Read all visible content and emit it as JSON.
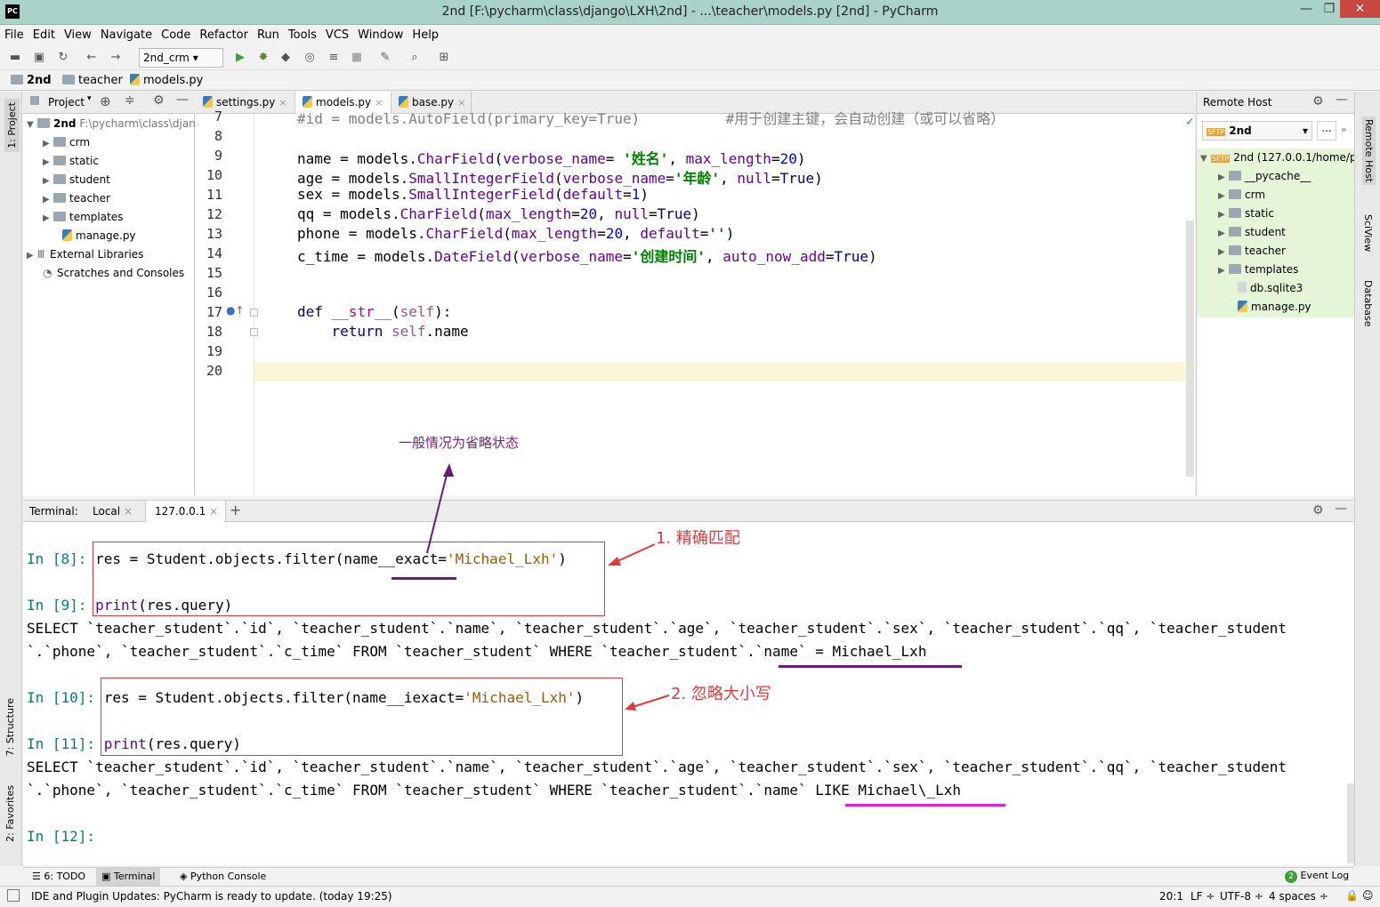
{
  "window": {
    "title": "2nd [F:\\pycharm\\class\\django\\LXH\\2nd] - ...\\teacher\\models.py [2nd] - PyCharm",
    "app_icon": "PC"
  },
  "menu": [
    "File",
    "Edit",
    "View",
    "Navigate",
    "Code",
    "Refactor",
    "Run",
    "Tools",
    "VCS",
    "Window",
    "Help"
  ],
  "toolbar": {
    "run_config": "2nd_crm"
  },
  "breadcrumb": {
    "root": "2nd",
    "folder": "teacher",
    "file": "models.py"
  },
  "left_strip": {
    "project": "1: Project",
    "structure": "7: Structure",
    "favorites": "2: Favorites"
  },
  "project": {
    "header": "Project",
    "root_name": "2nd",
    "root_path": "F:\\pycharm\\class\\djan",
    "folders": [
      "crm",
      "static",
      "student",
      "teacher",
      "templates"
    ],
    "file": "manage.py",
    "external": "External Libraries",
    "scratches": "Scratches and Consoles"
  },
  "tabs": [
    "settings.py",
    "models.py",
    "base.py"
  ],
  "editor": {
    "line_numbers": [
      "7",
      "8",
      "9",
      "10",
      "11",
      "12",
      "13",
      "14",
      "15",
      "16",
      "17",
      "18",
      "19",
      "20"
    ],
    "line7": "#id = models.AutoField(primary_key=True)          #用于创建主键，会自动创建（或可以省略）",
    "annotation": "一般情况为省略状态"
  },
  "remote_host": {
    "header": "Remote Host",
    "server": "2nd",
    "root": "2nd (127.0.0.1/home/py",
    "folders": [
      "__pycache__",
      "crm",
      "static",
      "student",
      "teacher",
      "templates"
    ],
    "files": [
      "db.sqlite3",
      "manage.py"
    ]
  },
  "right_strip": {
    "remote": "Remote Host",
    "sciview": "SciView",
    "database": "Database"
  },
  "terminal": {
    "label": "Terminal:",
    "tabs": [
      "Local",
      "127.0.0.1"
    ],
    "p8": "In [8]:",
    "p9": "In [9]:",
    "p10": "In [10]:",
    "p11": "In [11]:",
    "p12": "In [12]:",
    "sql1a": "SELECT `teacher_student`.`id`, `teacher_student`.`name`, `teacher_student`.`age`, `teacher_student`.`sex`, `teacher_student`.`qq`, `teacher_student",
    "sql1b": "`.`phone`, `teacher_student`.`c_time` FROM `teacher_student` WHERE `teacher_student`.`name` = Michael_Lxh",
    "sql2a": "SELECT `teacher_student`.`id`, `teacher_student`.`name`, `teacher_student`.`age`, `teacher_student`.`sex`, `teacher_student`.`qq`, `teacher_student",
    "sql2b": "`.`phone`, `teacher_student`.`c_time` FROM `teacher_student` WHERE `teacher_student`.`name` LIKE Michael\\_Lxh",
    "ann1": "1. 精确匹配",
    "ann2": "2. 忽略大小写"
  },
  "tool_windows": [
    "6: TODO",
    "Terminal",
    "Python Console",
    "Event Log"
  ],
  "event_count": "2",
  "status": {
    "message": "IDE and Plugin Updates: PyCharm is ready to update. (today 19:25)",
    "position": "20:1",
    "line_sep": "LF ÷",
    "encoding": "UTF-8 ÷",
    "indent": "4 spaces ÷"
  },
  "colors": {
    "titlebar": "#a9d3c8",
    "annotation_red": "#e03a3a",
    "underline_purple": "#6a1a7a",
    "underline_magenta": "#e020e0"
  }
}
